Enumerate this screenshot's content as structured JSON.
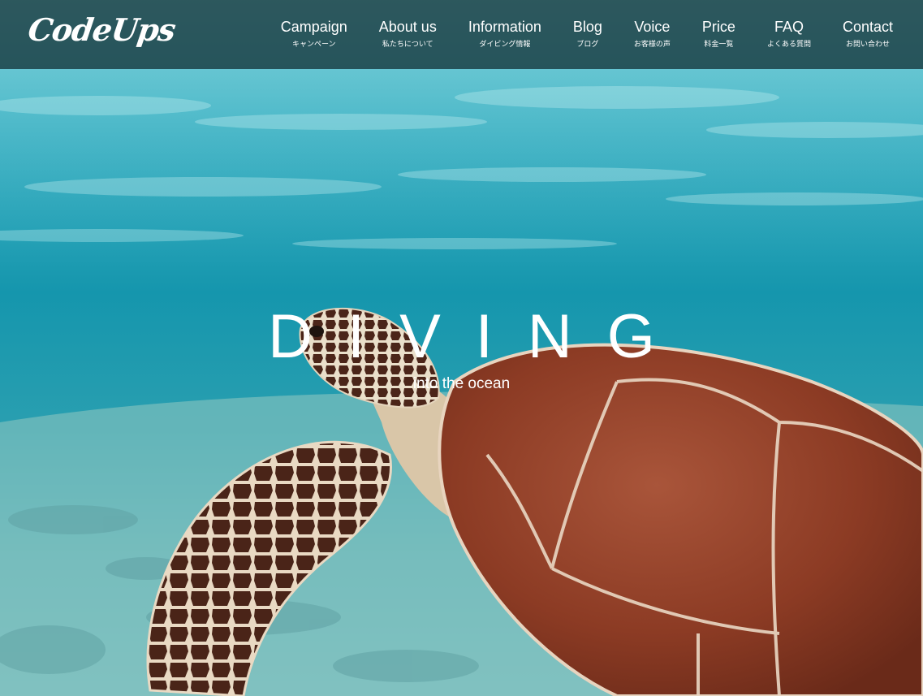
{
  "header": {
    "logo": "CodeUps",
    "nav": [
      {
        "en": "Campaign",
        "ja": "キャンペーン"
      },
      {
        "en": "About us",
        "ja": "私たちについて"
      },
      {
        "en": "Information",
        "ja": "ダイビング情報"
      },
      {
        "en": "Blog",
        "ja": "ブログ"
      },
      {
        "en": "Voice",
        "ja": "お客様の声"
      },
      {
        "en": "Price",
        "ja": "料金一覧"
      },
      {
        "en": "FAQ",
        "ja": "よくある質問"
      },
      {
        "en": "Contact",
        "ja": "お問い合わせ"
      }
    ]
  },
  "hero": {
    "title": "DIVING",
    "subtitle": "into the ocean",
    "image": "sea-turtle-underwater"
  },
  "colors": {
    "header_bg": "#14343a",
    "water_top": "#5fc3cf",
    "water_deep": "#0f8ea6",
    "sand": "#8fc9c8",
    "shell": "#8a3a24",
    "text": "#ffffff"
  }
}
